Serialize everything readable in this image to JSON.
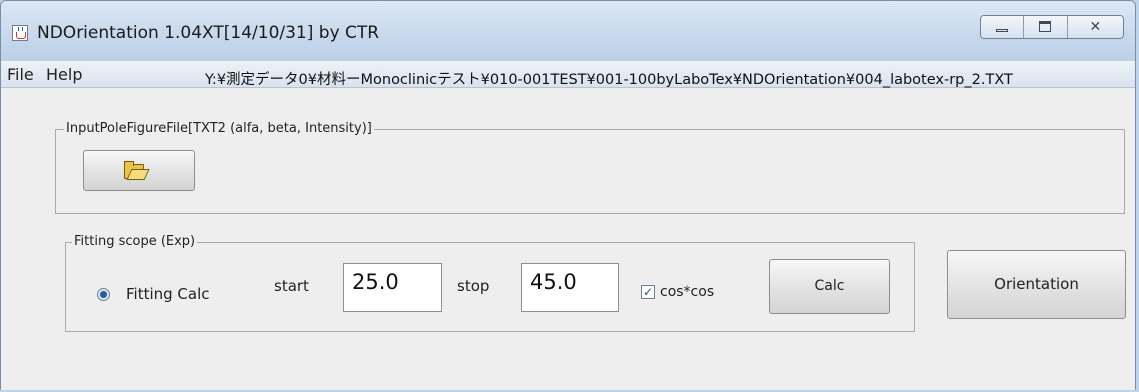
{
  "window": {
    "title": "NDOrientation 1.04XT[14/10/31] by CTR",
    "close_glyph": "✕"
  },
  "menu": {
    "items": [
      "File",
      "Help"
    ]
  },
  "input_group": {
    "label": "InputPoleFigureFile[TXT2 (alfa, beta, Intensity)]",
    "file_path": "Y:¥測定データ0¥材料ーMonoclinicテスト¥010-001TEST¥001-100byLaboTex¥NDOrientation¥004_labotex-rp_2.TXT"
  },
  "fitting_group": {
    "label": "Fitting scope (Exp)",
    "radio_label": "Fitting Calc",
    "radio_selected": true,
    "start_label": "start",
    "start_value": "25.0",
    "stop_label": "stop",
    "stop_value": "45.0",
    "checkbox_label": "cos*cos",
    "checkbox_checked": true,
    "checkbox_glyph": "✓",
    "calc_label": "Calc"
  },
  "orientation_label": "Orientation",
  "colors": {
    "title_gradient_top": "#dbe8f6",
    "client_bg": "#eeeeee",
    "radio_dot": "#2a5b9c"
  }
}
